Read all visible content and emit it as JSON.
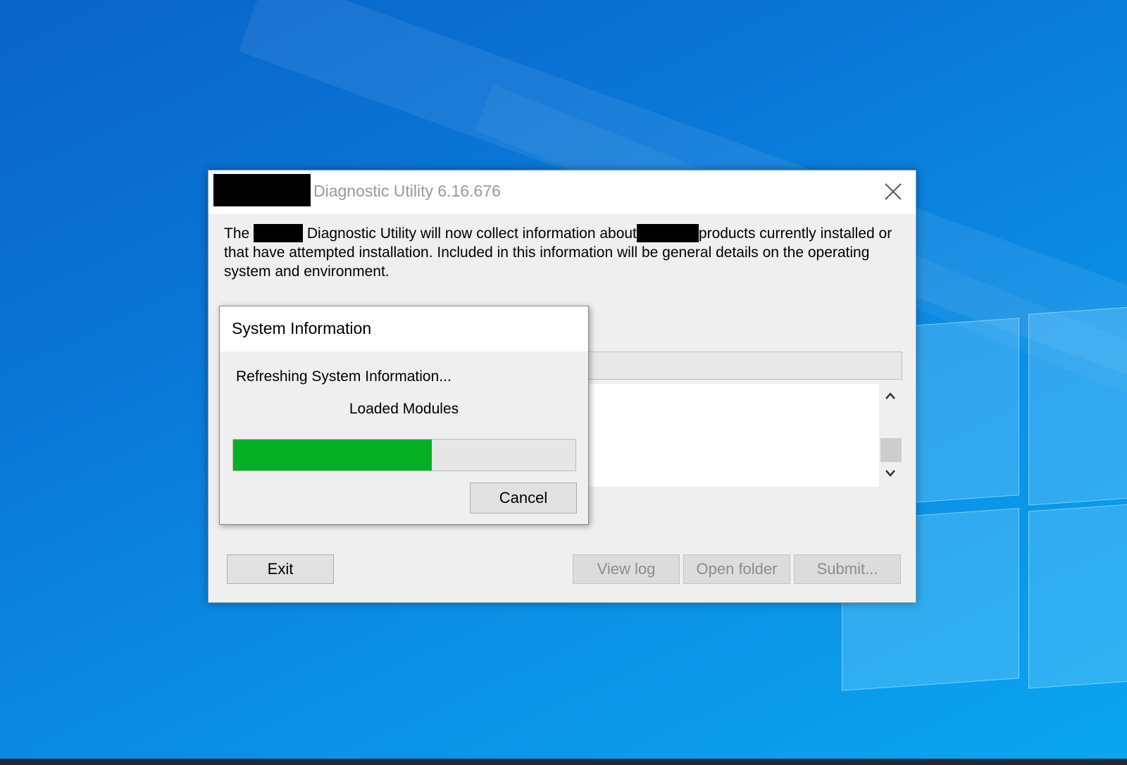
{
  "main_window": {
    "title": "Diagnostic Utility 6.16.676",
    "description": {
      "part1": "The ",
      "part2": " Diagnostic Utility will now collect information about",
      "part3": "products currently installed or that have attempted installation. Included in this information will be general details on the operating system and environment."
    },
    "buttons": {
      "exit": "Exit",
      "view_log": "View log",
      "open_folder": "Open folder",
      "submit": "Submit..."
    }
  },
  "progress_dialog": {
    "title": "System Information",
    "status": "Refreshing System Information...",
    "current_item": "Loaded Modules",
    "progress": 0.58,
    "cancel_label": "Cancel"
  },
  "icons": {
    "close": "close-icon",
    "scroll_up": "chevron-up-icon",
    "scroll_down": "chevron-down-icon"
  },
  "colors": {
    "progress_fill": "#06b025",
    "desktop": "#0a78d8"
  }
}
